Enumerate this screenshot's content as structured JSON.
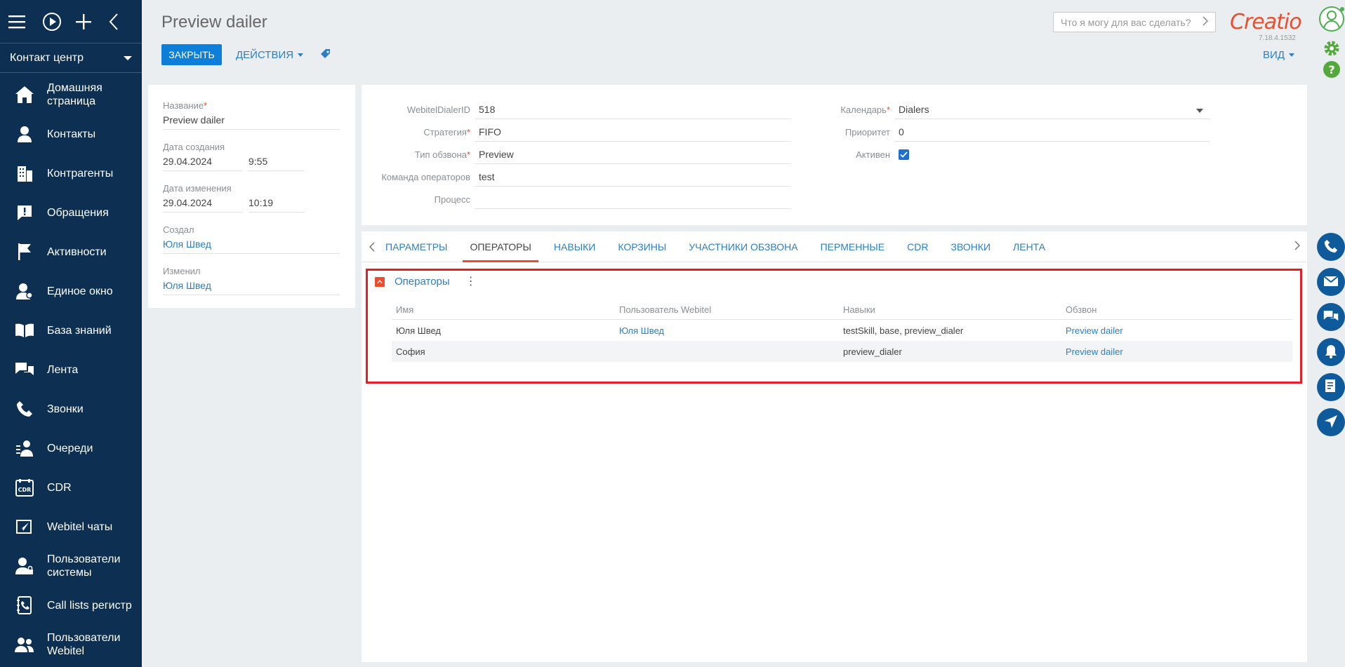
{
  "sidebar": {
    "section": "Контакт центр",
    "items": [
      {
        "label": "Домашняя страница",
        "icon": "home-icon"
      },
      {
        "label": "Контакты",
        "icon": "person-icon"
      },
      {
        "label": "Контрагенты",
        "icon": "building-icon"
      },
      {
        "label": "Обращения",
        "icon": "alert-icon"
      },
      {
        "label": "Активности",
        "icon": "flag-icon"
      },
      {
        "label": "Единое окно",
        "icon": "user-window-icon"
      },
      {
        "label": "База знаний",
        "icon": "book-icon"
      },
      {
        "label": "Лента",
        "icon": "chat-icon"
      },
      {
        "label": "Звонки",
        "icon": "phone-icon"
      },
      {
        "label": "Очереди",
        "icon": "queue-icon"
      },
      {
        "label": "CDR",
        "icon": "cdr-icon"
      },
      {
        "label": "Webitel чаты",
        "icon": "send-icon"
      },
      {
        "label": "Пользователи системы",
        "icon": "user-lock-icon"
      },
      {
        "label": "Call lists регистр",
        "icon": "phone-book-icon"
      },
      {
        "label": "Пользователи Webitel",
        "icon": "users-icon"
      }
    ]
  },
  "header": {
    "title": "Preview dailer",
    "close_label": "ЗАКРЫТЬ",
    "actions_label": "ДЕЙСТВИЯ",
    "view_label": "ВИД",
    "search_placeholder": "Что я могу для вас сделать?",
    "logo": "Creatio",
    "version": "7.18.4.1532"
  },
  "left": {
    "name_label": "Название",
    "name_value": "Preview dailer",
    "created_label": "Дата создания",
    "created_date": "29.04.2024",
    "created_time": "9:55",
    "modified_label": "Дата изменения",
    "modified_date": "29.04.2024",
    "modified_time": "10:19",
    "creator_label": "Создал",
    "creator_value": "Юля Швед",
    "modifier_label": "Изменил",
    "modifier_value": "Юля Швед"
  },
  "form": {
    "dialer_id_label": "WebitelDialerID",
    "dialer_id_value": "518",
    "strategy_label": "Стратегия",
    "strategy_value": "FIFO",
    "call_type_label": "Тип обзвона",
    "call_type_value": "Preview",
    "team_label": "Команда операторов",
    "team_value": "test",
    "process_label": "Процесс",
    "process_value": "",
    "calendar_label": "Календарь",
    "calendar_value": "Dialers",
    "priority_label": "Приоритет",
    "priority_value": "0",
    "active_label": "Активен"
  },
  "tabs": [
    "ПАРАМЕТРЫ",
    "ОПЕРАТОРЫ",
    "НАВЫКИ",
    "КОРЗИНЫ",
    "УЧАСТНИКИ ОБЗВОНА",
    "ПЕРМЕННЫЕ",
    "CDR",
    "ЗВОНКИ",
    "ЛЕНТА"
  ],
  "detail": {
    "title": "Операторы",
    "columns": [
      "Имя",
      "Пользователь Webitel",
      "Навыки",
      "Обзвон"
    ],
    "rows": [
      {
        "name": "Юля Швед",
        "user": "Юля Швед",
        "skills": "testSkill, base, preview_dialer",
        "dialer": "Preview dailer"
      },
      {
        "name": "София",
        "user": "",
        "skills": "preview_dialer",
        "dialer": "Preview dailer"
      }
    ]
  },
  "colors": {
    "sidebar_bg": "#0d3052",
    "accent_blue": "#0d7fd9",
    "link_blue": "#2d7fc4",
    "brand_orange": "#e94f2e",
    "highlight_red": "#e41e26"
  }
}
